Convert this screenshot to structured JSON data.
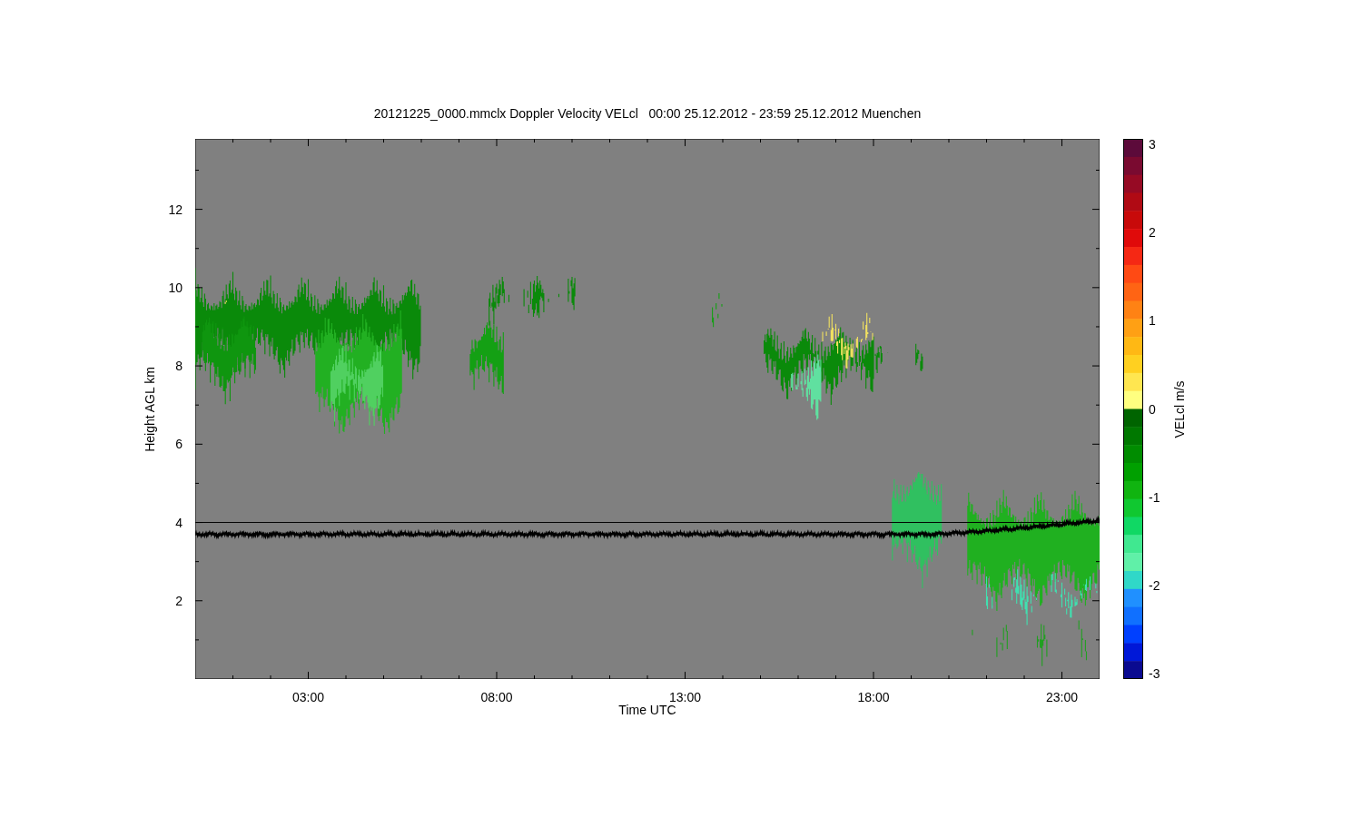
{
  "title": "20121225_0000.mmclx Doppler Velocity VELcl   00:00 25.12.2012 - 23:59 25.12.2012 Muenchen",
  "y_axis": {
    "label": "Height AGL km",
    "ticks": [
      "12",
      "10",
      "8",
      "6",
      "4",
      "2"
    ]
  },
  "x_axis": {
    "label": "Time UTC",
    "ticks": [
      "03:00",
      "08:00",
      "13:00",
      "18:00",
      "23:00"
    ]
  },
  "colorbar": {
    "label": "VELcl m/s",
    "ticks": [
      "3",
      "2",
      "1",
      "0",
      "-1",
      "-2",
      "-3"
    ]
  }
}
